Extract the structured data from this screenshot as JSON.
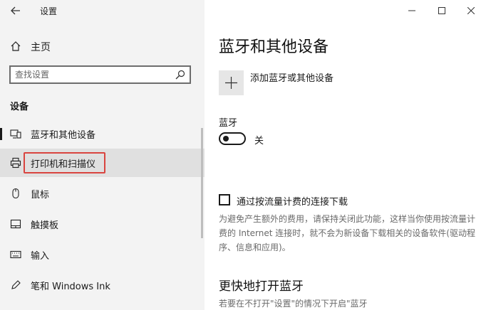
{
  "window": {
    "app_title": "设置"
  },
  "sidebar": {
    "home_label": "主页",
    "search": {
      "placeholder": "查找设置"
    },
    "section": "设备",
    "items": [
      {
        "label": "蓝牙和其他设备",
        "icon": "bluetooth-devices-icon"
      },
      {
        "label": "打印机和扫描仪",
        "icon": "printer-icon"
      },
      {
        "label": "鼠标",
        "icon": "mouse-icon"
      },
      {
        "label": "触摸板",
        "icon": "touchpad-icon"
      },
      {
        "label": "输入",
        "icon": "keyboard-icon"
      },
      {
        "label": "笔和 Windows Ink",
        "icon": "pen-icon"
      }
    ]
  },
  "main": {
    "title": "蓝牙和其他设备",
    "add_device_label": "添加蓝牙或其他设备",
    "bluetooth_label": "蓝牙",
    "bluetooth_state": "关",
    "metered_label": "通过按流量计费的连接下载",
    "metered_description": "为避免产生额外的费用，请保持关闭此功能，这样当你使用按流量计费的 Internet 连接时，就不会为新设备下载相关的设备软件(驱动程序、信息和应用)。",
    "quick_title": "更快地打开蓝牙",
    "quick_description": "若要在不打开\"设置\"的情况下开启\"蓝牙"
  },
  "colors": {
    "highlight": "#d9443f",
    "sidebar_bg": "#f3f3f3"
  }
}
